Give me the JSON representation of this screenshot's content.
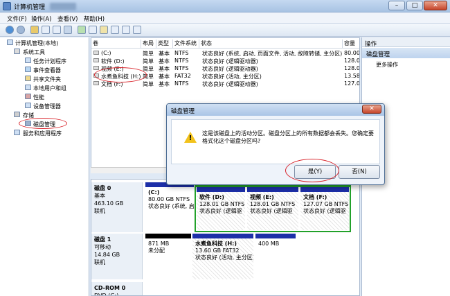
{
  "window": {
    "title": "计算机管理",
    "min": "–",
    "max": "□",
    "close": "✕"
  },
  "menu": [
    "文件(F)",
    "操作(A)",
    "查看(V)",
    "帮助(H)"
  ],
  "tree": {
    "root": "计算机管理(本地)",
    "system_tools": "系统工具",
    "items": [
      "任务计划程序",
      "事件查看器",
      "共享文件夹",
      "本地用户和组",
      "性能",
      "设备管理器"
    ],
    "storage": "存储",
    "disk_mgmt": "磁盘管理",
    "services": "服务和应用程序"
  },
  "volumes": {
    "headers": [
      "卷",
      "布局",
      "类型",
      "文件系统",
      "状态",
      "容量"
    ],
    "rows": [
      [
        "(C:)",
        "简单",
        "基本",
        "NTFS",
        "状态良好 (系统, 启动, 页面文件, 活动, 故障转储, 主分区)",
        "80.00"
      ],
      [
        "软件 (D:)",
        "简单",
        "基本",
        "NTFS",
        "状态良好 (逻辑驱动器)",
        "128.01"
      ],
      [
        "视频 (E:)",
        "简单",
        "基本",
        "NTFS",
        "状态良好 (逻辑驱动器)",
        "128.01"
      ],
      [
        "水煮鱼科技 (H:)",
        "简单",
        "基本",
        "FAT32",
        "状态良好 (活动, 主分区)",
        "13.58"
      ],
      [
        "文档 (F:)",
        "简单",
        "基本",
        "NTFS",
        "状态良好 (逻辑驱动器)",
        "127.07"
      ]
    ]
  },
  "disks": [
    {
      "name": "磁盘 0",
      "kind": "基本",
      "size": "463.10 GB",
      "state": "联机",
      "parts": [
        {
          "l1": "(C:)",
          "l2": "80.00 GB NTFS",
          "l3": "状态良好 (系统, 启"
        },
        {
          "l1": "软件  (D:)",
          "l2": "128.01 GB NTFS",
          "l3": "状态良好 (逻辑驱"
        },
        {
          "l1": "视频  (E:)",
          "l2": "128.01 GB NTFS",
          "l3": "状态良好 (逻辑驱"
        },
        {
          "l1": "文档  (F:)",
          "l2": "127.07 GB NTFS",
          "l3": "状态良好 (逻辑驱"
        }
      ]
    },
    {
      "name": "磁盘 1",
      "kind": "可移动",
      "size": "14.84 GB",
      "state": "联机",
      "parts": [
        {
          "l1": "",
          "l2": "871 MB",
          "l3": "未分配"
        },
        {
          "l1": "水煮鱼科技  (H:)",
          "l2": "13.60 GB FAT32",
          "l3": "状态良好 (活动, 主分区)"
        },
        {
          "l1": "",
          "l2": "400 MB",
          "l3": ""
        }
      ]
    },
    {
      "name": "CD-ROM 0",
      "kind": "DVD (G:)"
    }
  ],
  "actions": {
    "header": "操作",
    "selected": "磁盘管理",
    "more": "更多操作"
  },
  "dialog": {
    "title": "磁盘管理",
    "message": "这是该磁盘上的活动分区。磁盘分区上的所有数据都会丢失。您确定要格式化这个磁盘分区吗?",
    "yes": "是(Y)",
    "no": "否(N)",
    "close": "✕"
  },
  "colors": {
    "primary_partition": "#1d2fa8",
    "logical_partition_border": "#22a12a",
    "unallocated": "#000000",
    "highlight": "#d9242b"
  }
}
